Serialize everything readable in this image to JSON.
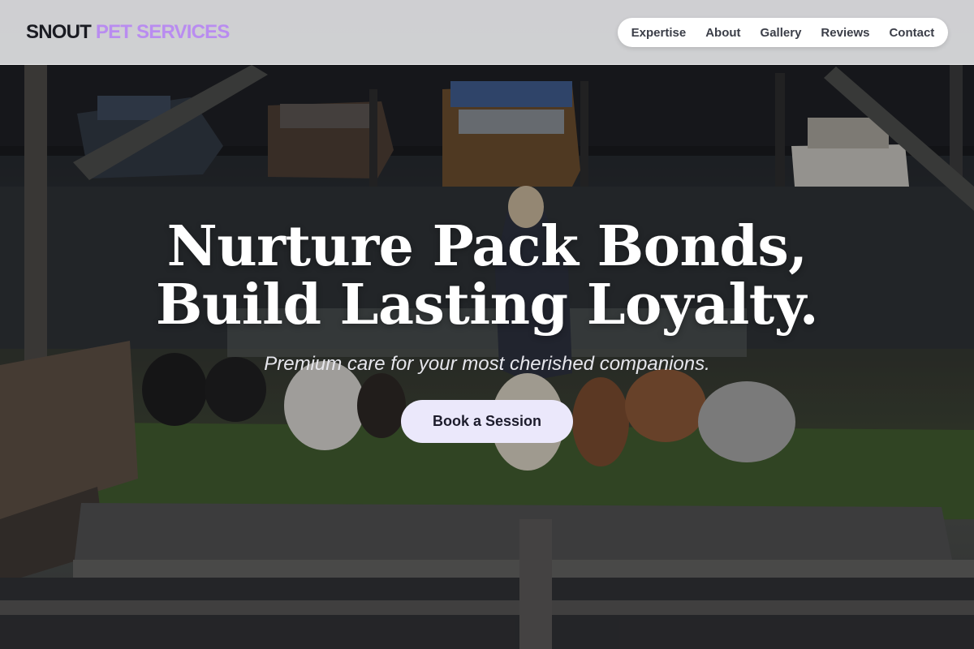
{
  "brand": {
    "name_part1": "SNOUT",
    "name_part2": "PET SERVICES",
    "color_primary": "#1a1b22",
    "color_accent": "#b98cf0"
  },
  "nav": {
    "items": [
      {
        "label": "Expertise"
      },
      {
        "label": "About"
      },
      {
        "label": "Gallery"
      },
      {
        "label": "Reviews"
      },
      {
        "label": "Contact"
      }
    ]
  },
  "hero": {
    "title_line1": "Nurture Pack Bonds,",
    "title_line2": "Build Lasting Loyalty.",
    "subtitle": "Premium care for your most cherished companions.",
    "cta_label": "Book a Session",
    "cta_background": "#ebe8fb",
    "background_image": "photo of a person walking a pack of dogs by a harbor with moored boats"
  }
}
